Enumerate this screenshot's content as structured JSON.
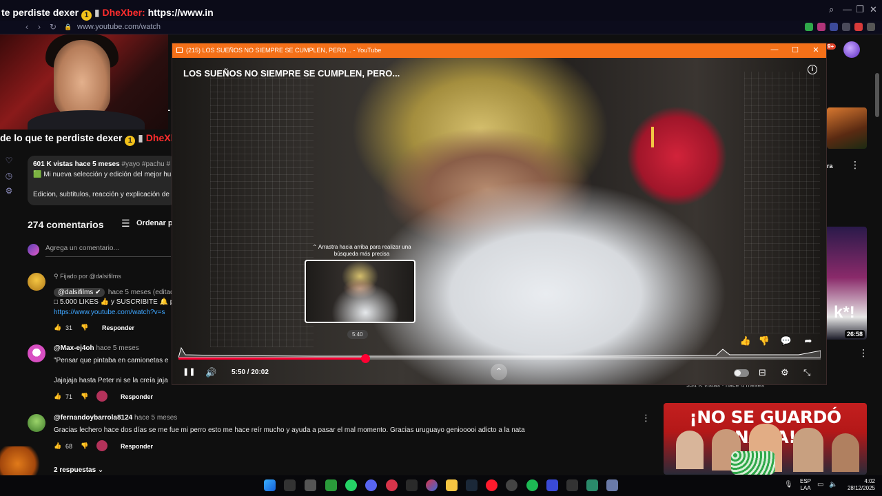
{
  "ticker": {
    "top": {
      "prefix": "te perdiste dexer",
      "coin": "1",
      "name": "DheXber:",
      "tail": "https://www.in"
    },
    "mid": {
      "prefix": "de lo que te perdiste dexer",
      "coin": "1",
      "name": "DheXber:",
      "tail": "http"
    }
  },
  "browser": {
    "url": "www.youtube.com/watch",
    "nav": {
      "back": "‹",
      "forward": "›",
      "reload": "↻",
      "lock": "🔒"
    },
    "window": {
      "search": "⌕",
      "minimize": "—",
      "restore": "❐",
      "close": "✕"
    },
    "badge": "9+"
  },
  "rail": {
    "icons": [
      "✦",
      "⚇",
      "▣",
      "♡",
      "◷",
      "⚙"
    ]
  },
  "youtube": {
    "menu_icon": "☰",
    "channel_fragment": "o L",
    "description": {
      "meta": "601 K vistas  hace 5 meses",
      "tags": "#yayo #pachu #",
      "line1": "🟩 Mi nueva selección y edición del mejor hu",
      "line2": "Edicion, subtitulos, reacción y explicación de"
    },
    "comments_count": "274 comentarios",
    "sort_icon": "☰",
    "sort_label": "Ordenar po",
    "add_comment_placeholder": "Agrega un comentario...",
    "comments": [
      {
        "pinned": "⚲ Fijado por @dalsifilms",
        "handle": "@dalsifilms ✔",
        "time": "hace 5 meses (editado)",
        "line1": "□ 5.000 LIKES 👍 y SUSCRIBITE 🔔 pa",
        "link": "https://www.youtube.com/watch?v=s",
        "likes": "31",
        "reply": "Responder"
      },
      {
        "handle": "@Max-ej4oh",
        "time": "hace 5 meses",
        "line1": "\"Pensar que pintaba en camionetas e",
        "line2": "Jajajaja hasta Peter ni se la creía jaja",
        "likes": "71",
        "reply": "Responder"
      },
      {
        "handle": "@fernandoybarrola8124",
        "time": "hace 5 meses",
        "line1": "Gracias lechero hace dos días se me fue mi perro esto me hace reír mucho y ayuda a pasar el mal momento. Gracias uruguayo geniooooi adicto a la nata",
        "likes": "68",
        "reply": "Responder",
        "more_icon": "⋮"
      }
    ],
    "replies_toggle": "2 respuestas",
    "sidebar": {
      "top_fragment": "ra",
      "views": "334 K vistas · hace 4 meses",
      "mid_duration": "26:58",
      "mid_overlay": "k*!",
      "bottom_title": "¡NO SE GUARDÓ NADA!"
    }
  },
  "pip": {
    "window_title": "(215) LOS SUEÑOS NO SIEMPRE SE CUMPLEN, PERO... - YouTube",
    "controls": {
      "minimize": "—",
      "maximize": "☐",
      "close": "✕"
    },
    "video_title": "LOS SUEÑOS NO SIEMPRE SE CUMPLEN, PERO...",
    "info_icon": "i",
    "seek_hint": "⌃ Arrastra hacia arriba para realizar una búsqueda más precisa",
    "seek_preview_time": "5:40",
    "current_time": "5:50",
    "duration": "20:02",
    "time_display": "5:50 / 20:02",
    "progress_fraction": 0.291,
    "actions": {
      "like": "👍",
      "dislike": "👎",
      "comment": "💬",
      "share": "➦"
    },
    "player": {
      "pause": "❚❚",
      "volume": "🔊",
      "expand": "⌃",
      "subtitles": "⊟",
      "settings": "⚙",
      "exit_fullscreen": "⤡"
    }
  },
  "taskbar": {
    "lang_line1": "ESP",
    "lang_line2": "LAA",
    "time": "4:02",
    "date": "28/12/2025",
    "tray": {
      "mic": "🎙",
      "display": "▭",
      "volume": "🔈"
    }
  },
  "colors": {
    "pip_titlebar": "#f47018",
    "progress": "#ff0033",
    "youtube_red": "#ff0000",
    "link": "#3ea6ff"
  }
}
